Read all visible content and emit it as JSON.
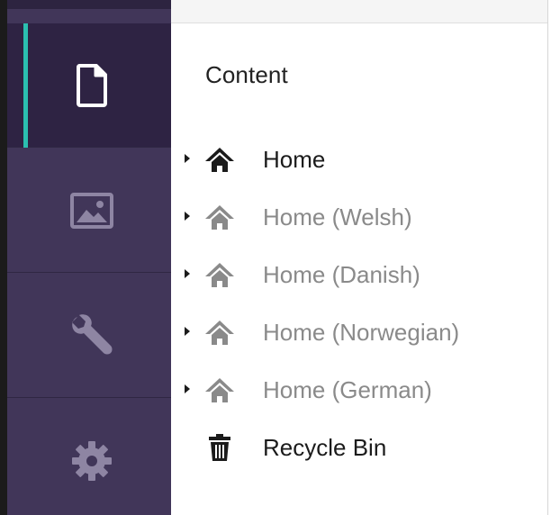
{
  "sections": {
    "items": [
      {
        "key": "content",
        "icon": "document-icon",
        "active": true
      },
      {
        "key": "media",
        "icon": "image-icon",
        "active": false
      },
      {
        "key": "developer",
        "icon": "wrench-icon",
        "active": false
      },
      {
        "key": "settings",
        "icon": "gear-icon",
        "active": false
      }
    ]
  },
  "tree": {
    "title": "Content",
    "nodes": [
      {
        "label": "Home",
        "icon": "home-icon",
        "has_children": true,
        "muted": false
      },
      {
        "label": "Home (Welsh)",
        "icon": "home-icon",
        "has_children": true,
        "muted": true
      },
      {
        "label": "Home (Danish)",
        "icon": "home-icon",
        "has_children": true,
        "muted": true
      },
      {
        "label": "Home (Norwegian)",
        "icon": "home-icon",
        "has_children": true,
        "muted": true
      },
      {
        "label": "Home (German)",
        "icon": "home-icon",
        "has_children": true,
        "muted": true
      },
      {
        "label": "Recycle Bin",
        "icon": "trash-icon",
        "has_children": false,
        "muted": false
      }
    ]
  },
  "colors": {
    "sidebar_bg": "#413659",
    "sidebar_active_bg": "#2e2343",
    "active_indicator": "#2bc0b0",
    "text_primary": "#1b1b1b",
    "text_muted": "#8a8a8a"
  }
}
